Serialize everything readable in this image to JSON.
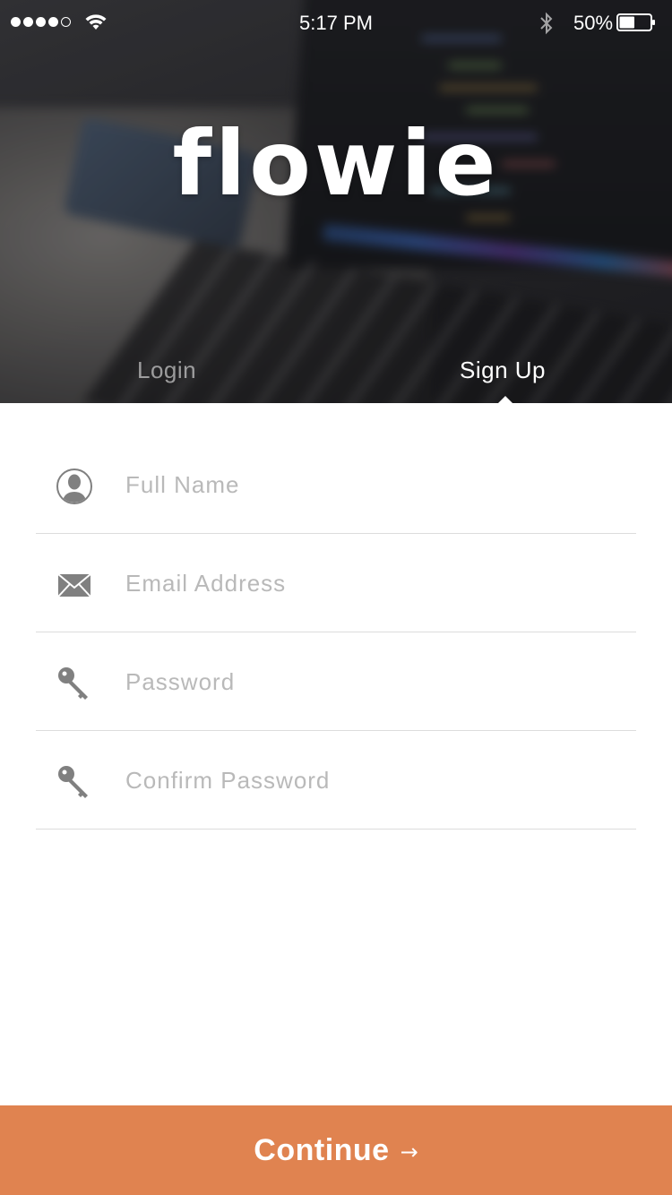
{
  "status_bar": {
    "time": "5:17 PM",
    "battery_percent": "50%",
    "signal_bars_filled": 4,
    "signal_bars_total": 5,
    "battery_level": 0.5,
    "icons": [
      "signal-dots",
      "wifi-icon",
      "bluetooth-icon",
      "battery-icon"
    ]
  },
  "app": {
    "logo_text": "flowie"
  },
  "tabs": [
    {
      "label": "Login",
      "active": false
    },
    {
      "label": "Sign Up",
      "active": true
    }
  ],
  "form": {
    "fields": [
      {
        "name": "full-name",
        "icon": "user-icon",
        "placeholder": "Full Name",
        "value": ""
      },
      {
        "name": "email",
        "icon": "envelope-icon",
        "placeholder": "Email Address",
        "value": ""
      },
      {
        "name": "password",
        "icon": "key-icon",
        "placeholder": "Password",
        "value": ""
      },
      {
        "name": "confirm-password",
        "icon": "key-icon",
        "placeholder": "Confirm Password",
        "value": ""
      }
    ]
  },
  "continue_button": {
    "label": "Continue",
    "arrow": "→"
  },
  "colors": {
    "accent": "#e08350",
    "icon_gray": "#808080",
    "placeholder": "#b9b9b9",
    "divider": "#dcdcdc"
  }
}
